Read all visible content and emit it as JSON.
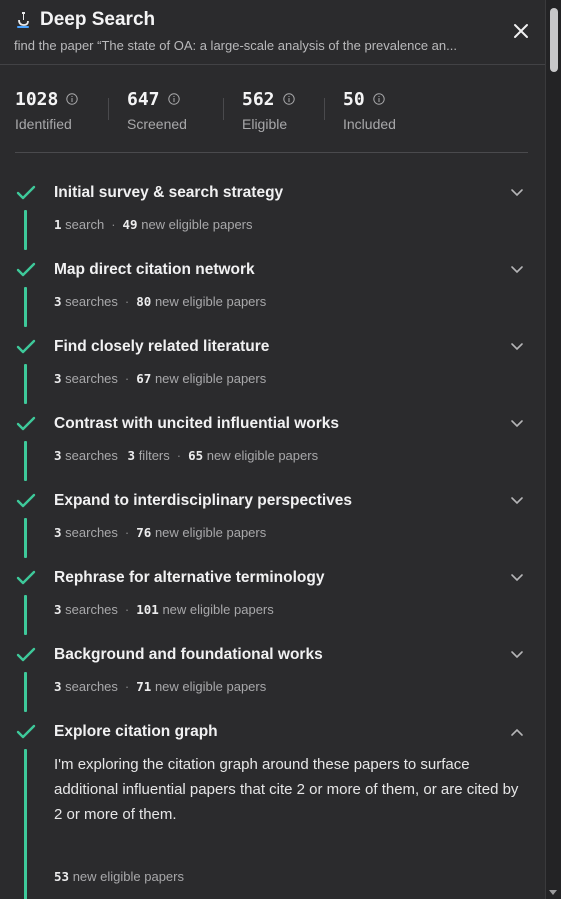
{
  "header": {
    "title": "Deep Search",
    "subtitle": "find the paper “The state of OA: a large-scale analysis of the prevalence an..."
  },
  "stats": [
    {
      "value": "1028",
      "label": "Identified"
    },
    {
      "value": "647",
      "label": "Screened"
    },
    {
      "value": "562",
      "label": "Eligible"
    },
    {
      "value": "50",
      "label": "Included"
    }
  ],
  "steps": [
    {
      "title": "Initial survey & search strategy",
      "searches": "1",
      "searches_label": "search",
      "papers": "49",
      "papers_label": "new eligible papers"
    },
    {
      "title": "Map direct citation network",
      "searches": "3",
      "searches_label": "searches",
      "papers": "80",
      "papers_label": "new eligible papers"
    },
    {
      "title": "Find closely related literature",
      "searches": "3",
      "searches_label": "searches",
      "papers": "67",
      "papers_label": "new eligible papers"
    },
    {
      "title": "Contrast with uncited influential works",
      "searches": "3",
      "searches_label": "searches",
      "filters": "3",
      "filters_label": "filters",
      "papers": "65",
      "papers_label": "new eligible papers"
    },
    {
      "title": "Expand to interdisciplinary perspectives",
      "searches": "3",
      "searches_label": "searches",
      "papers": "76",
      "papers_label": "new eligible papers"
    },
    {
      "title": "Rephrase for alternative terminology",
      "searches": "3",
      "searches_label": "searches",
      "papers": "101",
      "papers_label": "new eligible papers"
    },
    {
      "title": "Background and foundational works",
      "searches": "3",
      "searches_label": "searches",
      "papers": "71",
      "papers_label": "new eligible papers"
    },
    {
      "title": "Explore citation graph",
      "description": "I'm exploring the citation graph around these papers to surface additional influential papers that cite 2 or more of them, or are cited by 2 or more of them.",
      "papers": "53",
      "papers_label": "new eligible papers"
    }
  ],
  "icons": {
    "logo": "microscope-icon",
    "close": "close-icon",
    "info": "info-icon",
    "check": "check-icon",
    "chevron_down": "chevron-down-icon",
    "chevron_up": "chevron-up-icon"
  },
  "colors": {
    "accent": "#3ec99a",
    "logo_blue": "#4aa3ff",
    "background": "#2b2b2d"
  }
}
